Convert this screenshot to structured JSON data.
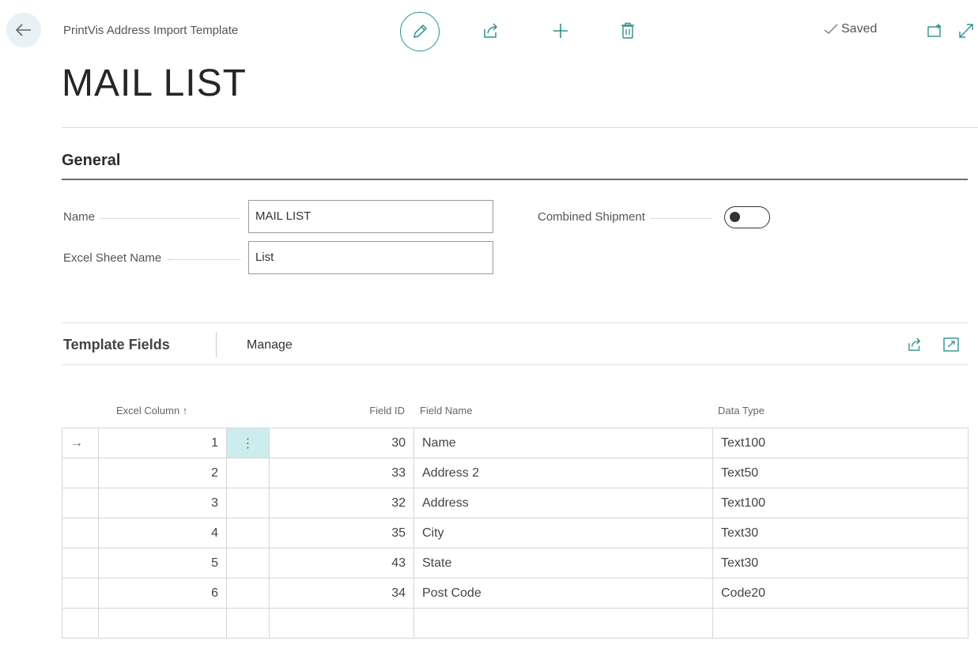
{
  "header": {
    "back_icon": "arrow-left-icon",
    "breadcrumb": "PrintVis Address Import Template",
    "toolbar": {
      "edit_icon": "pencil-icon",
      "share_icon": "share-icon",
      "new_icon": "plus-icon",
      "delete_icon": "trash-icon"
    },
    "saved_text": "Saved",
    "open_new_window_icon": "open-new-window-icon",
    "expand_icon": "expand-icon"
  },
  "page_title": "MAIL LIST",
  "general": {
    "section_title": "General",
    "name_label": "Name",
    "name_value": "MAIL LIST",
    "excel_sheet_label": "Excel Sheet Name",
    "excel_sheet_value": "List",
    "combined_shipment_label": "Combined Shipment",
    "combined_shipment_on": false
  },
  "template_fields": {
    "title": "Template Fields",
    "manage_label": "Manage",
    "columns": {
      "excel_column": "Excel Column ↑",
      "field_id": "Field ID",
      "field_name": "Field Name",
      "data_type": "Data Type"
    },
    "rows": [
      {
        "excel_column": "1",
        "field_id": "30",
        "field_name": "Name",
        "data_type": "Text100",
        "current": true
      },
      {
        "excel_column": "2",
        "field_id": "33",
        "field_name": "Address 2",
        "data_type": "Text50"
      },
      {
        "excel_column": "3",
        "field_id": "32",
        "field_name": "Address",
        "data_type": "Text100"
      },
      {
        "excel_column": "4",
        "field_id": "35",
        "field_name": "City",
        "data_type": "Text30"
      },
      {
        "excel_column": "5",
        "field_id": "43",
        "field_name": "State",
        "data_type": "Text30"
      },
      {
        "excel_column": "6",
        "field_id": "34",
        "field_name": "Post Code",
        "data_type": "Code20"
      }
    ],
    "current_row_marker": "→",
    "row_menu_glyph": "⋮"
  },
  "colors": {
    "accent": "#2f8f8f",
    "selected_cell": "#cdeced"
  }
}
